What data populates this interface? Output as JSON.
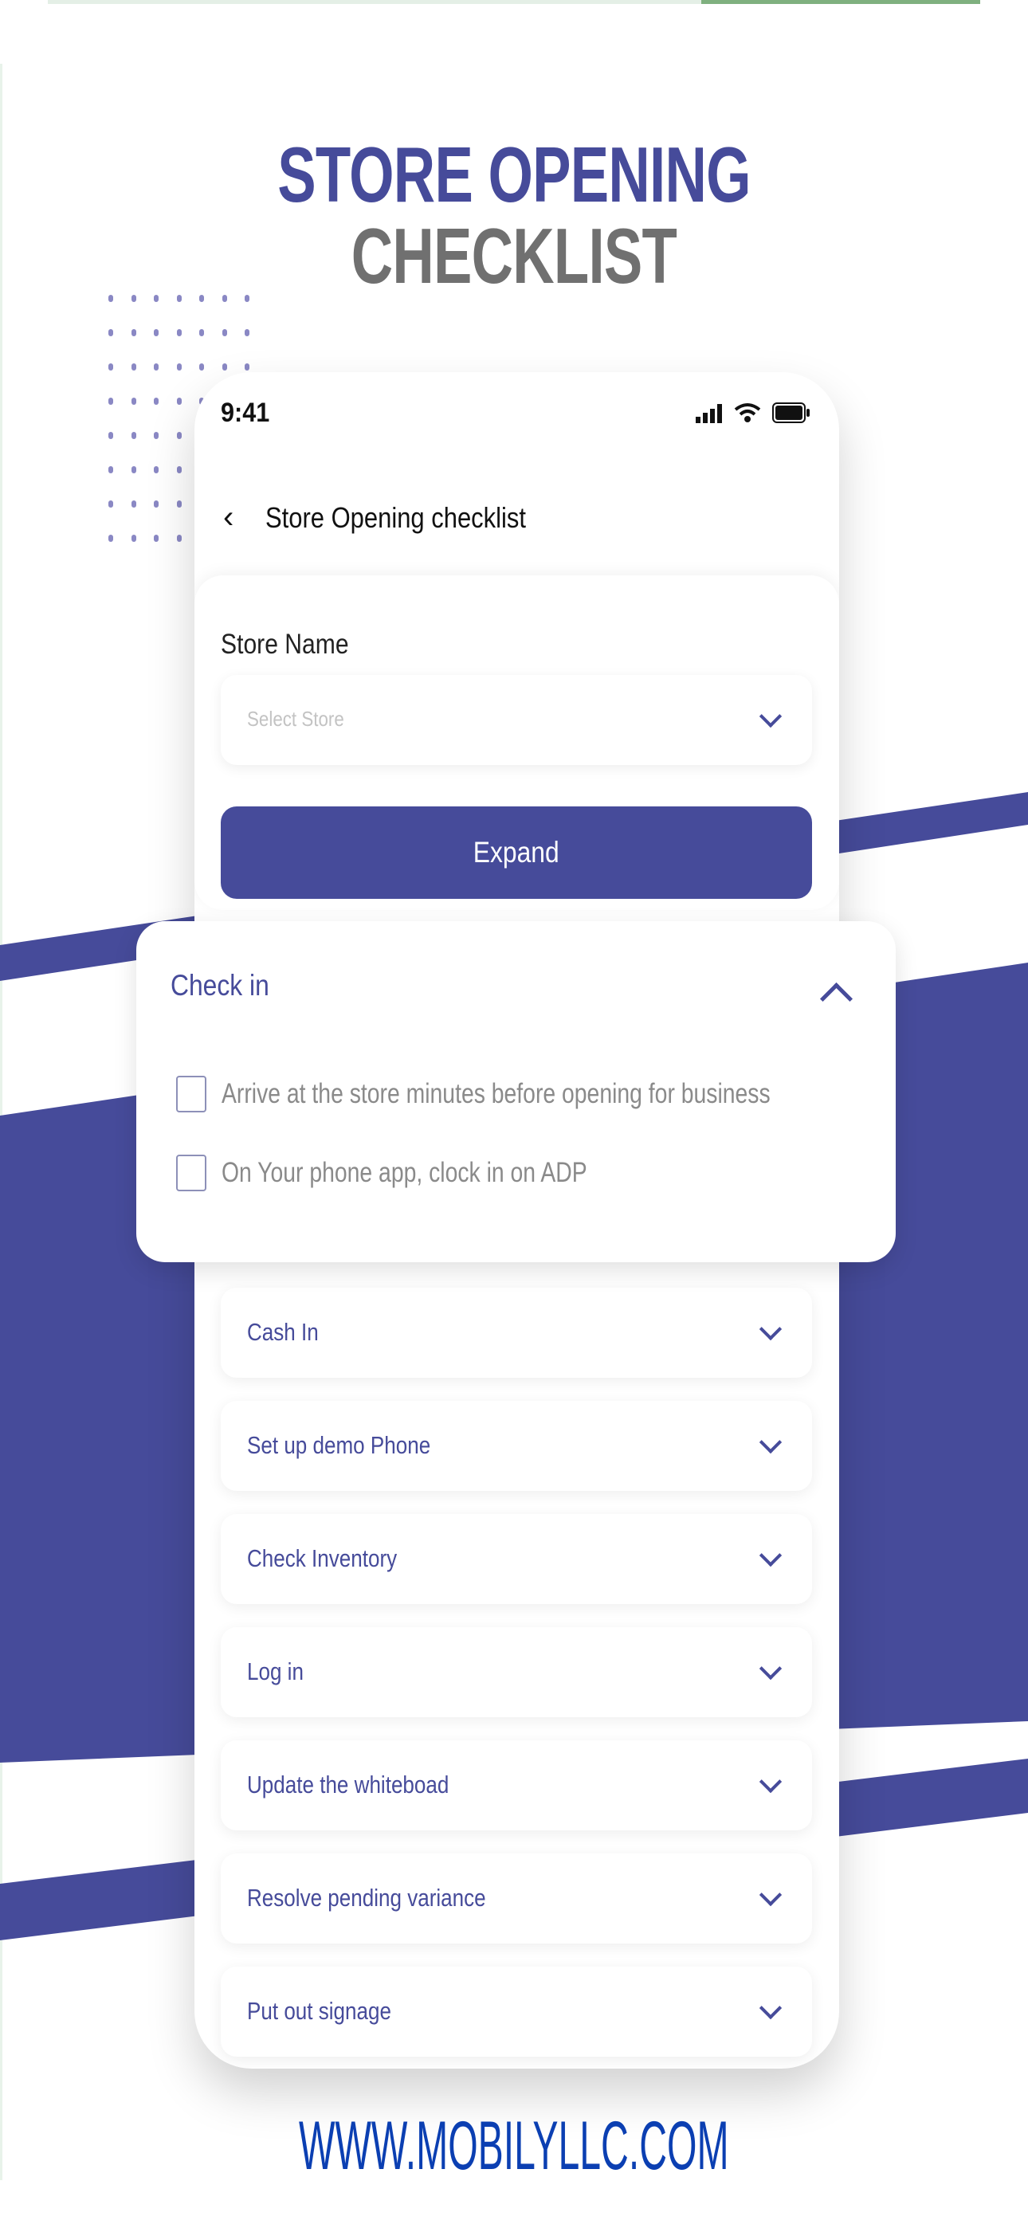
{
  "colors": {
    "accent": "#464b9a",
    "title_gray": "#707070",
    "footer_blue": "#0b3fb2"
  },
  "promo": {
    "title_line1": "STORE OPENING",
    "title_line2": "CHECKLIST",
    "footer_url": "WWW.MOBILYLLC.COM"
  },
  "status_bar": {
    "time": "9:41",
    "icons": [
      "signal-icon",
      "wifi-icon",
      "battery-icon"
    ]
  },
  "header": {
    "back_icon": "chevron-left-icon",
    "title": "Store Opening checklist"
  },
  "store": {
    "label": "Store Name",
    "placeholder": "Select Store",
    "expand_label": "Expand"
  },
  "check_in": {
    "title": "Check in",
    "expanded": true,
    "tasks": [
      {
        "label": "Arrive at the store minutes before opening for business",
        "checked": false
      },
      {
        "label": "On Your phone app, clock in on ADP",
        "checked": false
      }
    ]
  },
  "sections": [
    {
      "label": "Cash In"
    },
    {
      "label": "Set up demo Phone"
    },
    {
      "label": "Check Inventory"
    },
    {
      "label": "Log in"
    },
    {
      "label": "Update the whiteboad"
    },
    {
      "label": "Resolve pending variance"
    },
    {
      "label": "Put out signage"
    }
  ]
}
